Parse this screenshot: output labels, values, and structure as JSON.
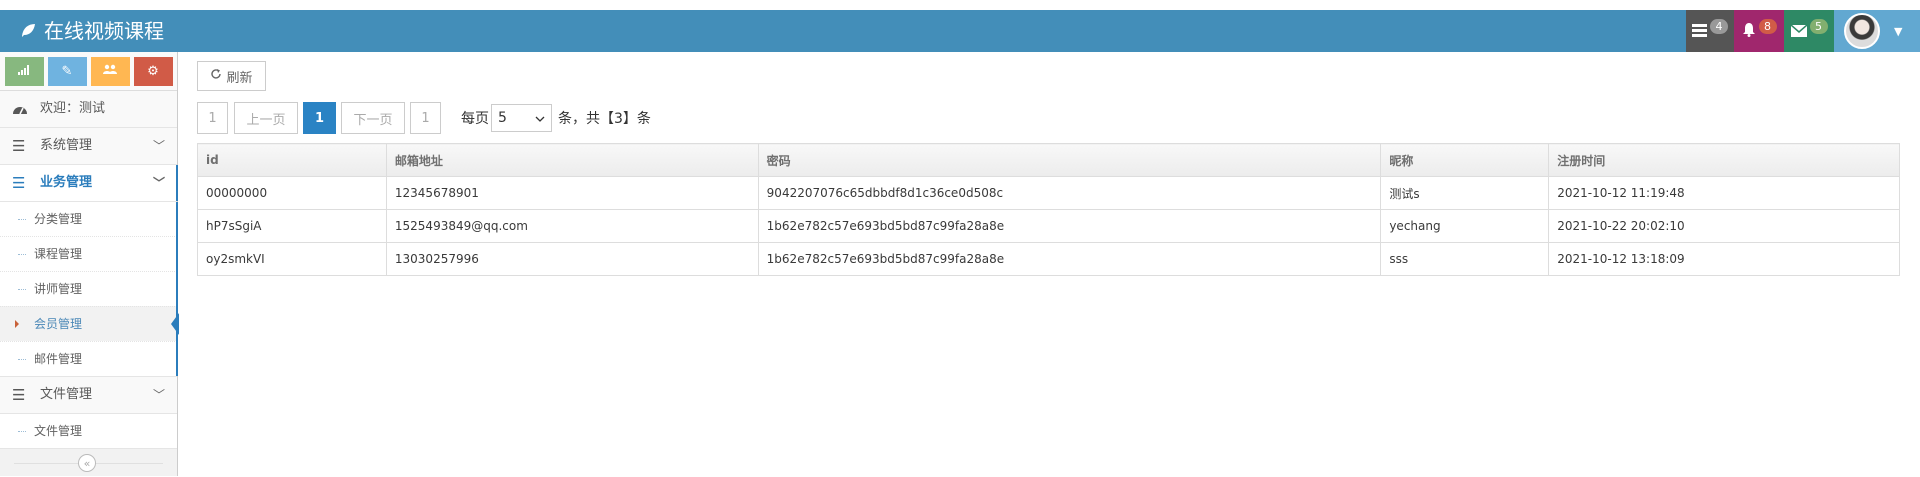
{
  "app": {
    "title": "在线视频课程"
  },
  "navbar": {
    "tasks_badge": "4",
    "notifications_badge": "8",
    "messages_badge": "5",
    "colors": {
      "bar": "#438eb9",
      "tasks": "#555555",
      "notifications": "#a0276d",
      "messages": "#2e8965",
      "user": "#62a8d1"
    }
  },
  "sidebar": {
    "shortcut_icons": [
      "signal-icon",
      "pencil-icon",
      "users-icon",
      "cogs-icon"
    ],
    "welcome": "欢迎：测试",
    "groups": [
      {
        "label": "系统管理",
        "icon": "list-icon",
        "expanded": false
      },
      {
        "label": "业务管理",
        "icon": "list-icon",
        "expanded": true,
        "items": [
          "分类管理",
          "课程管理",
          "讲师管理",
          "会员管理",
          "邮件管理"
        ],
        "current_index": 3
      },
      {
        "label": "文件管理",
        "icon": "list-icon",
        "expanded": true,
        "items": [
          "文件管理"
        ]
      }
    ],
    "collapse_symbol": "«"
  },
  "toolbar": {
    "refresh_label": "刷新"
  },
  "pager": {
    "first": "1",
    "prev": "上一页",
    "current": "1",
    "next": "下一页",
    "last": "1",
    "per_page_label": "每页",
    "per_page_value": "5",
    "total_text": "条，共【3】条"
  },
  "table": {
    "columns": [
      "id",
      "邮箱地址",
      "密码",
      "昵称",
      "注册时间"
    ],
    "rows": [
      [
        "00000000",
        "12345678901",
        "9042207076c65dbbdf8d1c36ce0d508c",
        "测试s",
        "2021-10-12 11:19:48"
      ],
      [
        "hP7sSgiA",
        "1525493849@qq.com",
        "1b62e782c57e693bd5bd87c99fa28a8e",
        "yechang",
        "2021-10-22 20:02:10"
      ],
      [
        "oy2smkVI",
        "13030257996",
        "1b62e782c57e693bd5bd87c99fa28a8e",
        "sss",
        "2021-10-12 13:18:09"
      ]
    ]
  }
}
